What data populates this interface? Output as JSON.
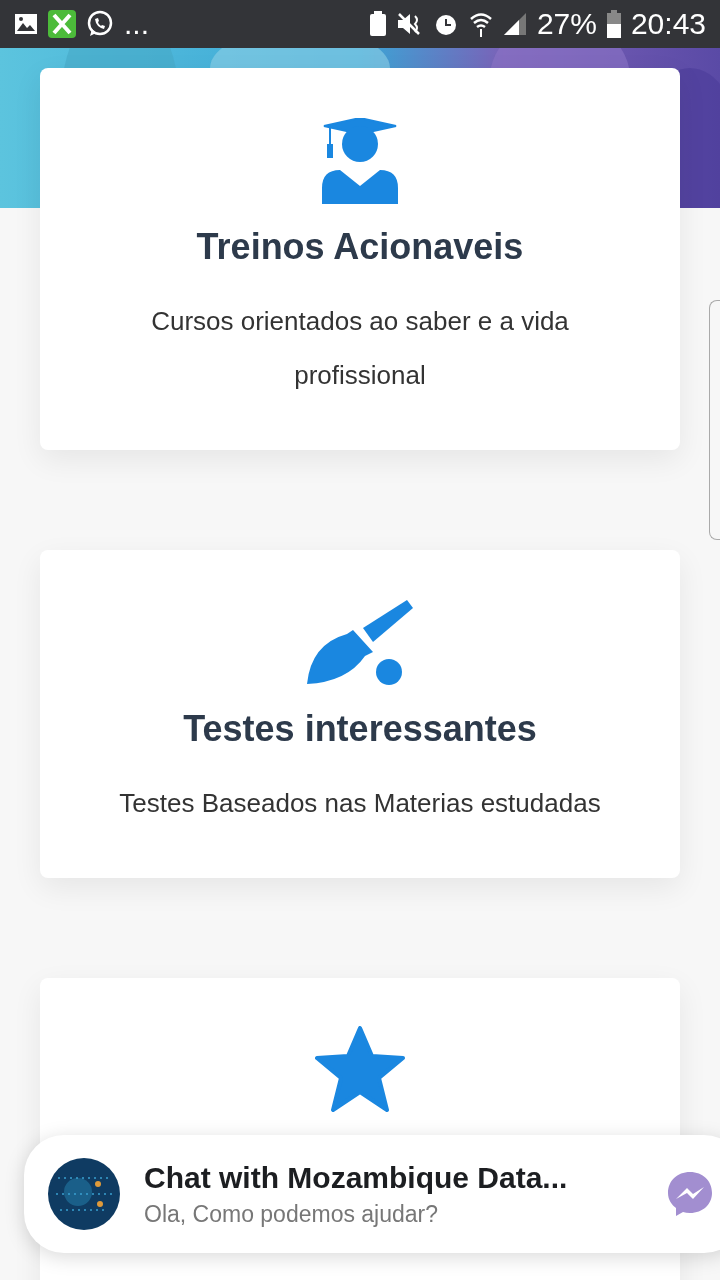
{
  "status_bar": {
    "more": "...",
    "battery": "27%",
    "time": "20:43"
  },
  "cards": [
    {
      "kind": "graduate",
      "title": "Treinos Acionaveis",
      "text": "Cursos orientados ao saber e a vida profissional"
    },
    {
      "kind": "brush",
      "title": "Testes interessantes",
      "text": "Testes Baseados nas Materias estudadas"
    },
    {
      "kind": "star"
    }
  ],
  "chat": {
    "title": "Chat with Mozambique Data...",
    "subtitle": "Ola, Como podemos ajudar?"
  }
}
